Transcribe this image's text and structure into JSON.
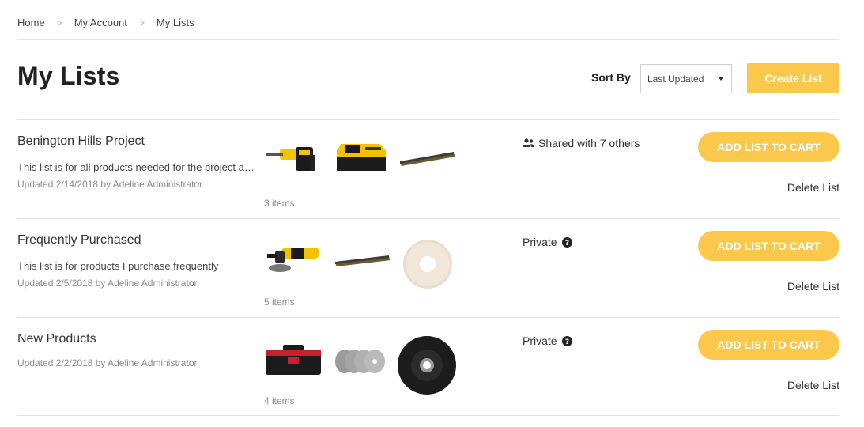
{
  "breadcrumb": {
    "items": [
      "Home",
      "My Account",
      "My Lists"
    ],
    "separator": ">"
  },
  "page": {
    "title": "My Lists"
  },
  "toolbar": {
    "sort_label": "Sort By",
    "sort_value": "Last Updated",
    "create_label": "Create List"
  },
  "colors": {
    "accent": "#fcc84c",
    "text": "#333333",
    "muted": "#8a8a8a",
    "divider": "#e1e1e1"
  },
  "lists": [
    {
      "name": "Benington Hills Project",
      "description": "This list is for all products needed for the project at Benington Hills",
      "updated": "Updated 2/14/2018 by Adeline Administrator",
      "items_count": "3 items",
      "status": "Shared with 7 others",
      "status_icon": "people-icon",
      "thumbnails": [
        "demolition-hammer",
        "battery-pack",
        "nail-strip"
      ],
      "cart_label": "ADD LIST TO CART",
      "delete_label": "Delete List"
    },
    {
      "name": "Frequently Purchased",
      "description": "This list is for products I purchase frequently",
      "updated": "Updated 2/5/2018 by Adeline Administrator",
      "items_count": "5 items",
      "status": "Private",
      "status_icon": "help-icon",
      "thumbnails": [
        "angle-grinder",
        "nail-strip",
        "felt-polishing-pad"
      ],
      "cart_label": "ADD LIST TO CART",
      "delete_label": "Delete List"
    },
    {
      "name": "New Products",
      "description": "",
      "updated": "Updated 2/2/2018 by Adeline Administrator",
      "items_count": "4 items",
      "status": "Private",
      "status_icon": "help-icon",
      "thumbnails": [
        "tool-box",
        "cutting-discs",
        "grinding-wheel"
      ],
      "cart_label": "ADD LIST TO CART",
      "delete_label": "Delete List"
    }
  ]
}
